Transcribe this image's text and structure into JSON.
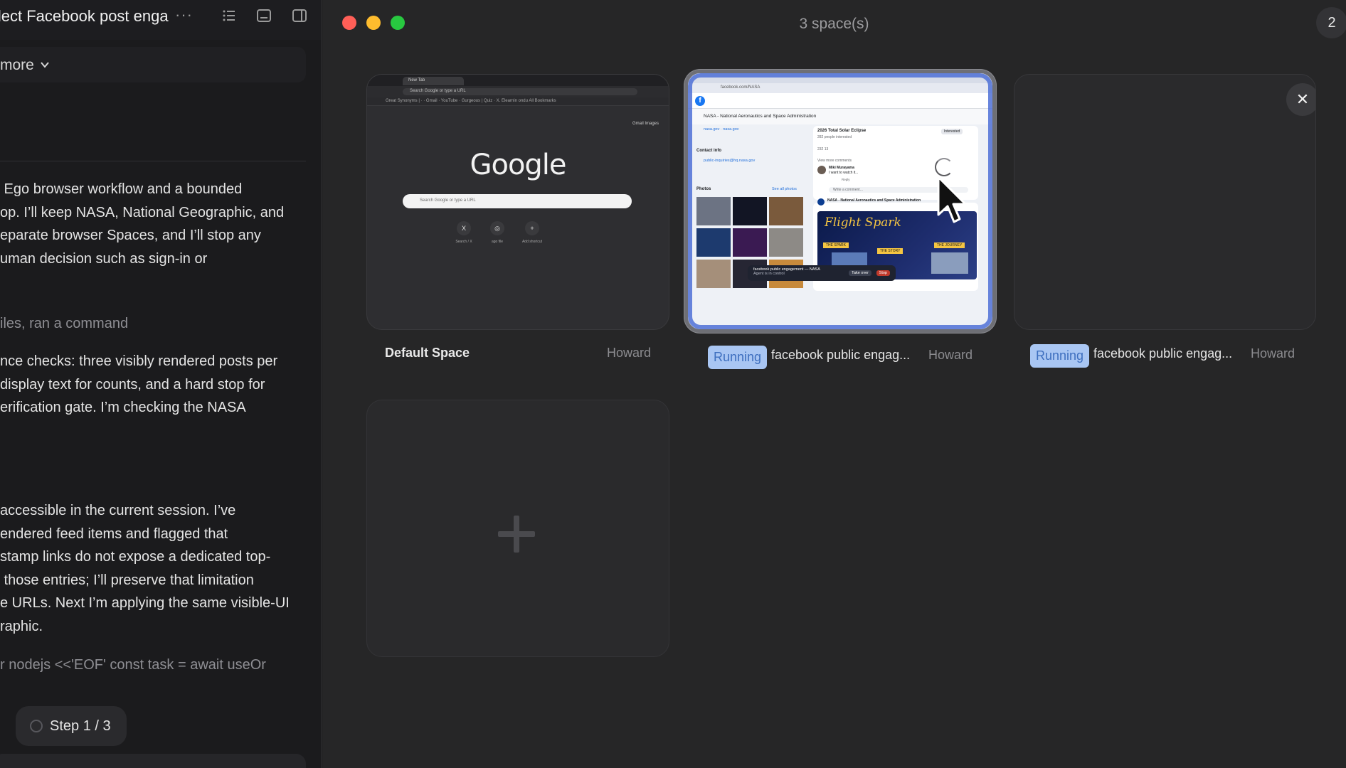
{
  "sidebar": {
    "title": "llect Facebook post enga",
    "more_dots": "···",
    "more_label": "more",
    "messages": [
      {
        "lines": [
          " Ego browser workflow and a bounded",
          "op. I’ll keep NASA, National Geographic, and",
          "eparate browser Spaces, and I’ll stop any",
          "uman decision such as sign-in or"
        ]
      },
      {
        "lines": [
          "iles, ran a command"
        ],
        "muted": true
      },
      {
        "lines": [
          "nce checks: three visibly rendered posts per",
          "display text for counts, and a hard stop for",
          "erification gate. I’m checking the NASA"
        ]
      },
      {
        "lines": [
          "accessible in the current session. I’ve",
          "endered feed items and flagged that",
          "stamp links do not expose a dedicated top-",
          " those entries; I’ll preserve that limitation",
          "e URLs. Next I’m applying the same visible-UI",
          "raphic."
        ]
      },
      {
        "lines": [
          "r nodejs <<'EOF' const task = await useOr"
        ],
        "muted": true
      }
    ],
    "step_label": "Step 1 / 3"
  },
  "window": {
    "title": "3 space(s)",
    "badge_count": "2",
    "traffic_colors": [
      "#ff5f57",
      "#febc2e",
      "#28c840"
    ]
  },
  "spaces": [
    {
      "name": "Default Space",
      "owner": "Howard",
      "preview": {
        "tab_label": "New Tab",
        "url_text": "Search Google or type a URL",
        "bookmarks": "Great Synonyms |  ·  ·  Gmail  ·  YouTube  ·  Gurgeous | Quiz  ·  X. Elearnin ondu                All Bookmarks",
        "top_links": "Gmail   Images",
        "logo": "Google",
        "search_placeholder": "Search Google or type a URL",
        "shortcuts": [
          {
            "glyph": "X",
            "label": "Search / X"
          },
          {
            "glyph": "◎",
            "label": "ago file"
          },
          {
            "glyph": "+",
            "label": "Add shortcut"
          }
        ]
      }
    },
    {
      "status": "Running",
      "title": "facebook public engag...",
      "owner": "Howard",
      "preview": {
        "url_text": "facebook.com/NASA",
        "page_name": "NASA - National Aeronautics and Space Administration",
        "links": "nasa.gov · nasa.gov",
        "contact_heading": "Contact info",
        "contact_email": "public-inquiries@hq.nasa.gov",
        "photos_heading": "Photos",
        "see_all": "See all photos",
        "event_title": "2026 Total Solar Eclipse",
        "event_sub": "282 people interested",
        "interested": "Interested",
        "reactions": "232   13",
        "view_more": "View more comments",
        "commenter": "Miki Murayama",
        "comment": "I want to watch it...",
        "reply": "Reply",
        "write_comment": "Write a comment...",
        "post_author": "NASA - National Aeronautics and Space Administration",
        "poster_title": "Flight Spark",
        "poster_tags": [
          "THE SPARK",
          "THE STORY",
          "THE JOURNEY"
        ],
        "toast_title": "facebook public engagement — NASA",
        "toast_sub": "Agent is in control",
        "toast_take": "Take over",
        "toast_stop": "Stop"
      }
    },
    {
      "status": "Running",
      "title": "facebook public engag...",
      "owner": "Howard",
      "close_glyph": "✕"
    }
  ]
}
